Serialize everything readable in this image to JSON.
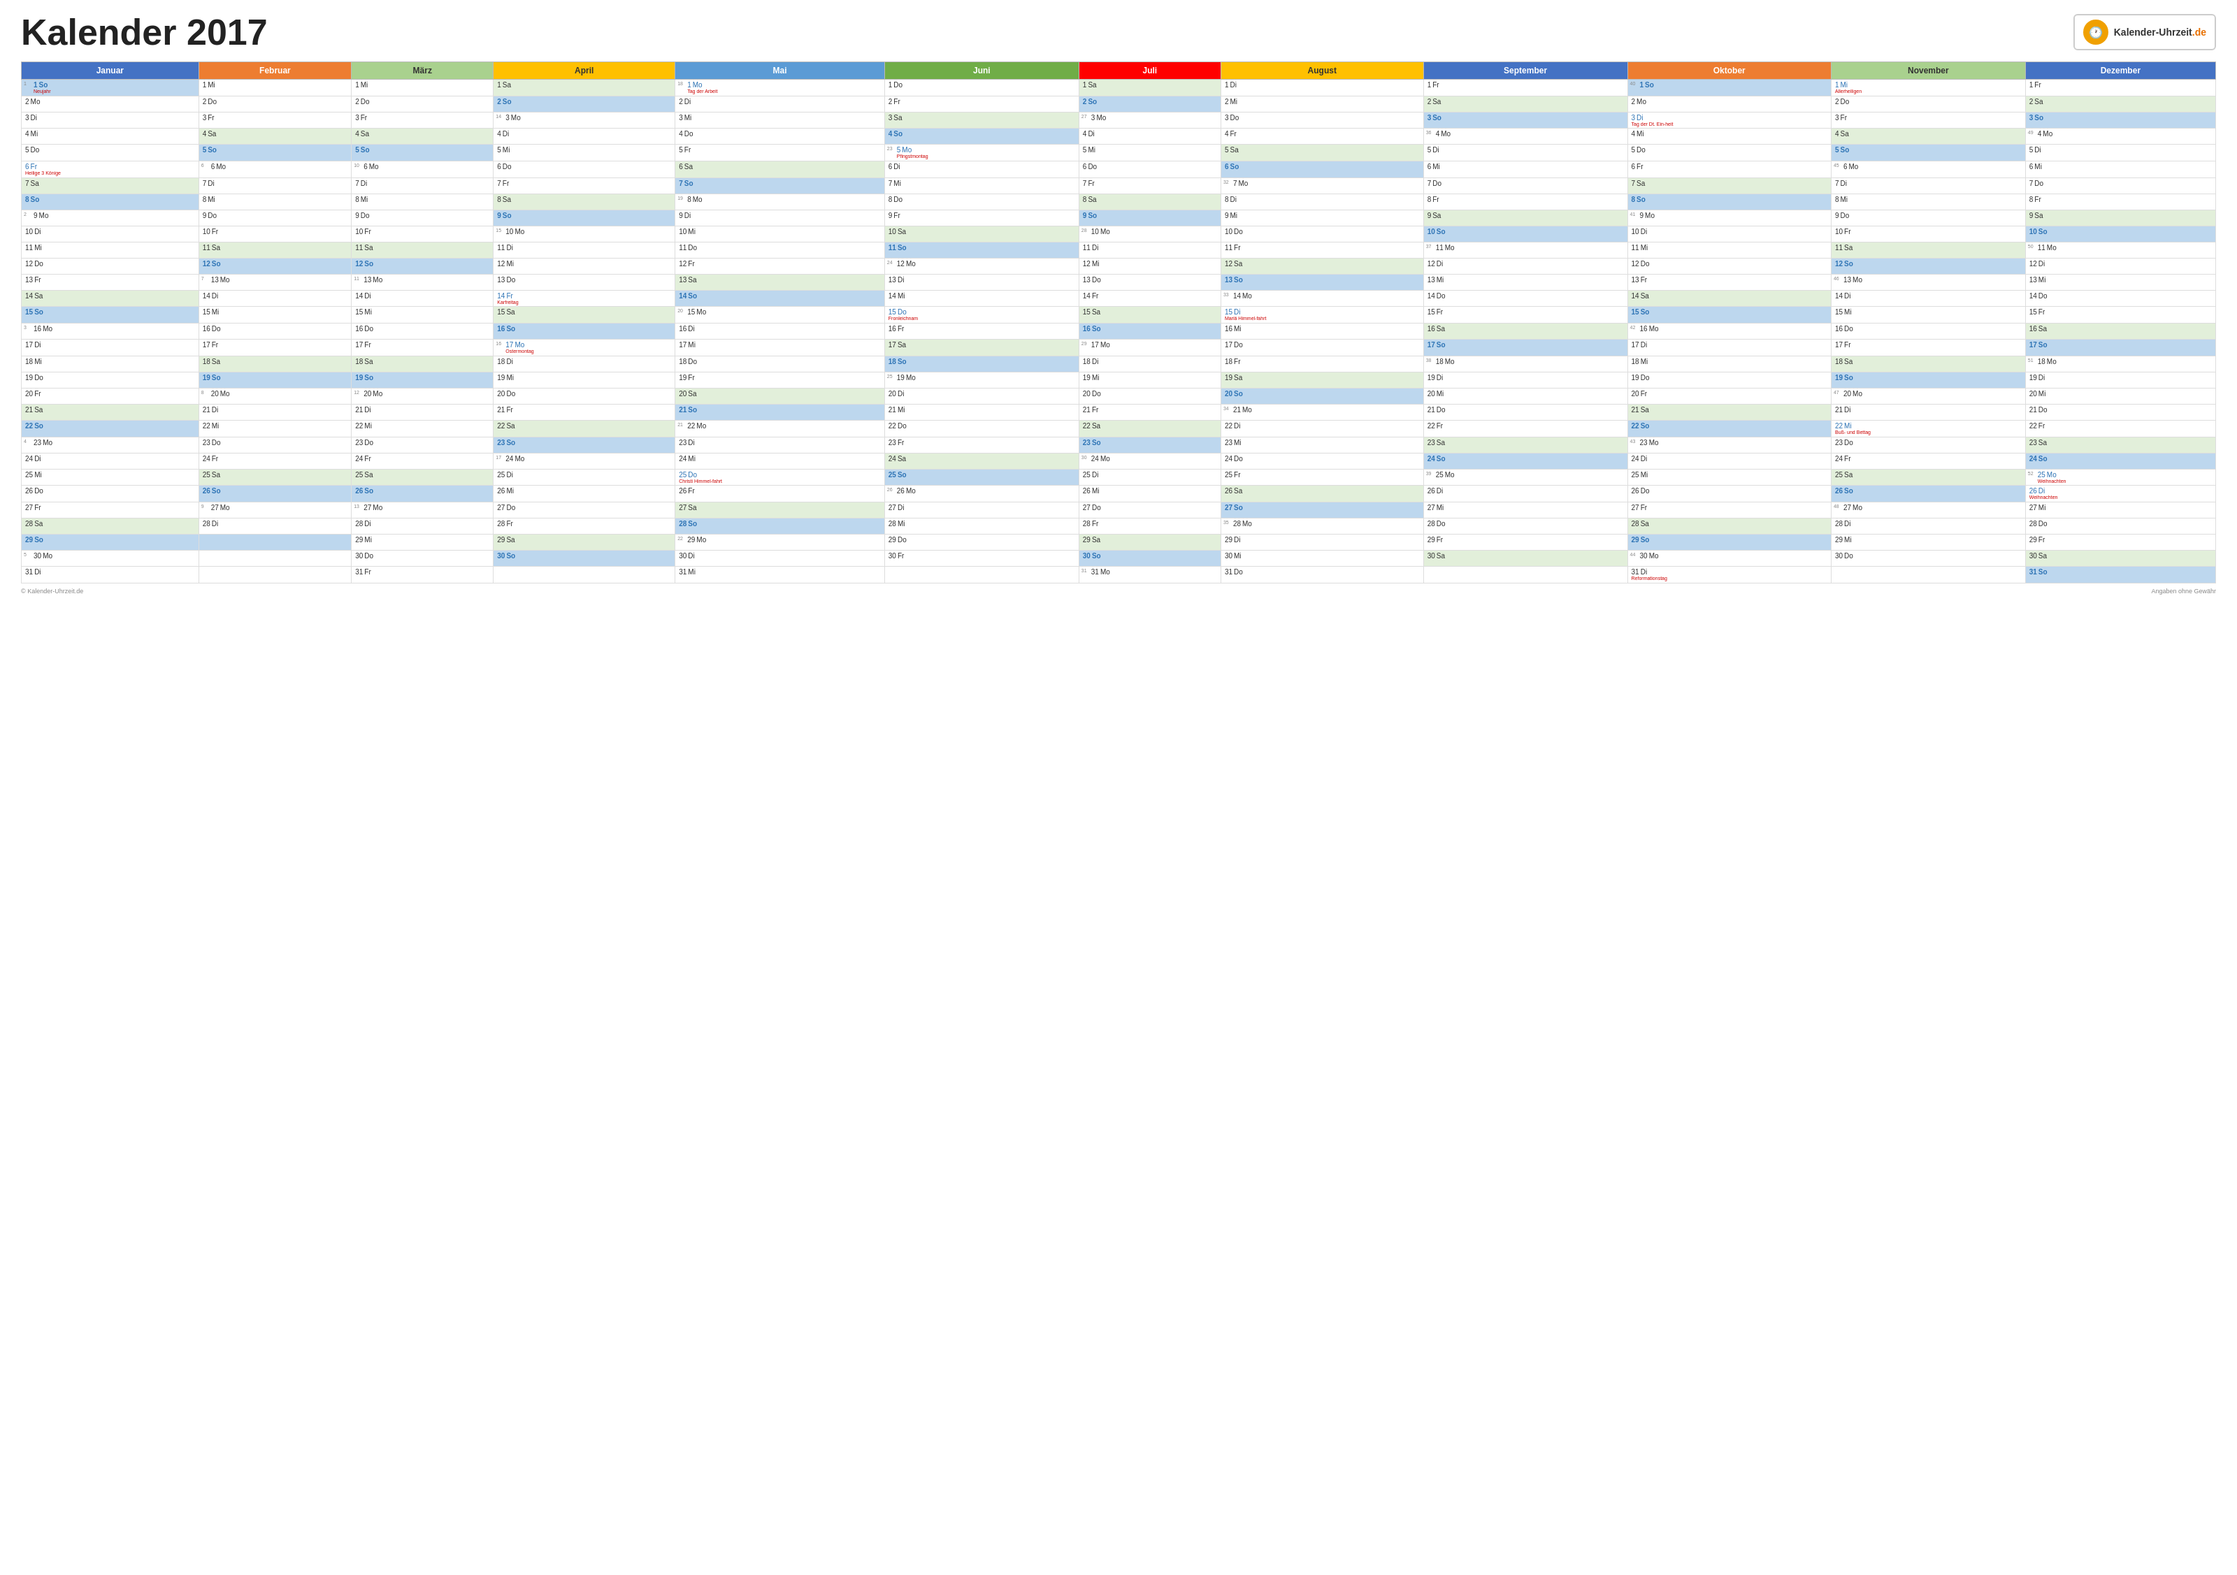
{
  "title": "Kalender 2017",
  "logo": {
    "icon": "🕐",
    "name": "Kalender-Uhrzeit",
    "domain": ".de"
  },
  "footer": {
    "copyright": "© Kalender-Uhrzeit.de",
    "disclaimer": "Angaben ohne Gewähr"
  },
  "months": [
    {
      "label": "Januar",
      "class": "month-jan"
    },
    {
      "label": "Februar",
      "class": "month-feb"
    },
    {
      "label": "März",
      "class": "month-mar"
    },
    {
      "label": "April",
      "class": "month-apr"
    },
    {
      "label": "Mai",
      "class": "month-mai"
    },
    {
      "label": "Juni",
      "class": "month-jun"
    },
    {
      "label": "Juli",
      "class": "month-jul"
    },
    {
      "label": "August",
      "class": "month-aug"
    },
    {
      "label": "September",
      "class": "month-sep"
    },
    {
      "label": "Oktober",
      "class": "month-okt"
    },
    {
      "label": "November",
      "class": "month-nov"
    },
    {
      "label": "Dezember",
      "class": "month-dez"
    }
  ]
}
